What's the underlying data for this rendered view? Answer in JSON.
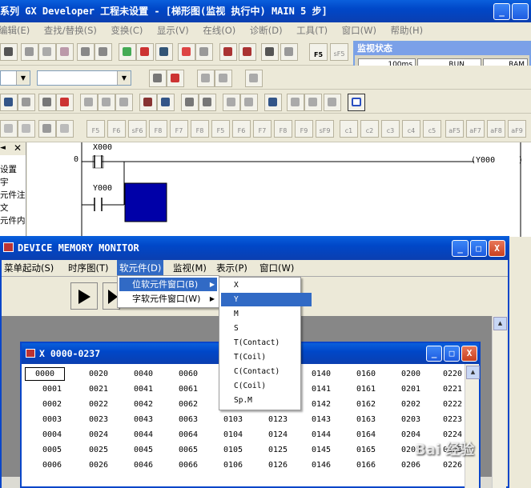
{
  "main_title": "系列 GX Developer 工程未设置 - [梯形图(监视 执行中)      MAIN     5 步]",
  "main_menu": [
    "编辑(E)",
    "查找/替换(S)",
    "变换(C)",
    "显示(V)",
    "在线(O)",
    "诊断(D)",
    "工具(T)",
    "窗口(W)",
    "帮助(H)"
  ],
  "monitor_status": {
    "title": "监视状态",
    "scan": "100ms",
    "state": "RUN",
    "memory": "RAM"
  },
  "left_pane_items": [
    "设置",
    "宇",
    "元件注",
    "文",
    "元件内"
  ],
  "ladder": {
    "step_0": "0",
    "contact_1": "X000",
    "contact_2": "Y000",
    "coil": "(Y000",
    "end_bracket": ")"
  },
  "device_monitor": {
    "title": "DEVICE MEMORY MONITOR",
    "menu": [
      "菜单起动(S)",
      "时序图(T)",
      "软元件(D)",
      "监视(M)",
      "表示(P)",
      "窗口(W)"
    ],
    "device_menu": [
      "位软元件窗口(B)",
      "字软元件窗口(W)"
    ],
    "bit_menu": [
      "X",
      "Y",
      "M",
      "S",
      "T(Contact)",
      "T(Coil)",
      "C(Contact)",
      "C(Coil)",
      "Sp.M"
    ]
  },
  "x_window": {
    "title": "X   0000-0237",
    "rows": [
      [
        "0000",
        "0020",
        "0040",
        "0060",
        "",
        "",
        "0140",
        "0160",
        "0200",
        "0220"
      ],
      [
        "0001",
        "0021",
        "0041",
        "0061",
        "",
        "",
        "0141",
        "0161",
        "0201",
        "0221"
      ],
      [
        "0002",
        "0022",
        "0042",
        "0062",
        "",
        "",
        "0142",
        "0162",
        "0202",
        "0222"
      ],
      [
        "0003",
        "0023",
        "0043",
        "0063",
        "0103",
        "0123",
        "0143",
        "0163",
        "0203",
        "0223"
      ],
      [
        "0004",
        "0024",
        "0044",
        "0064",
        "0104",
        "0124",
        "0144",
        "0164",
        "0204",
        "0224"
      ],
      [
        "0005",
        "0025",
        "0045",
        "0065",
        "0105",
        "0125",
        "0145",
        "0165",
        "0205",
        "0225"
      ],
      [
        "0006",
        "0026",
        "0046",
        "0066",
        "0106",
        "0126",
        "0146",
        "0166",
        "0206",
        "0226"
      ]
    ]
  },
  "window_controls": {
    "minimize": "_",
    "maximize": "□",
    "close": "X"
  },
  "fkeys_row1": [
    "F5",
    "sF5"
  ],
  "fkeys_row4": [
    "F5",
    "F6",
    "sF6",
    "F8",
    "F7",
    "F8",
    "F5",
    "F6",
    "F7",
    "F8",
    "F9",
    "sF9",
    "c1",
    "c2",
    "c3",
    "c4",
    "c5",
    "aF5",
    "aF7",
    "aF8",
    "aF9"
  ],
  "watermark": "Bai 经验",
  "colors": {
    "title_blue": "#0047c8",
    "selection": "#316ac5",
    "coil_fill": "#0000a8"
  }
}
